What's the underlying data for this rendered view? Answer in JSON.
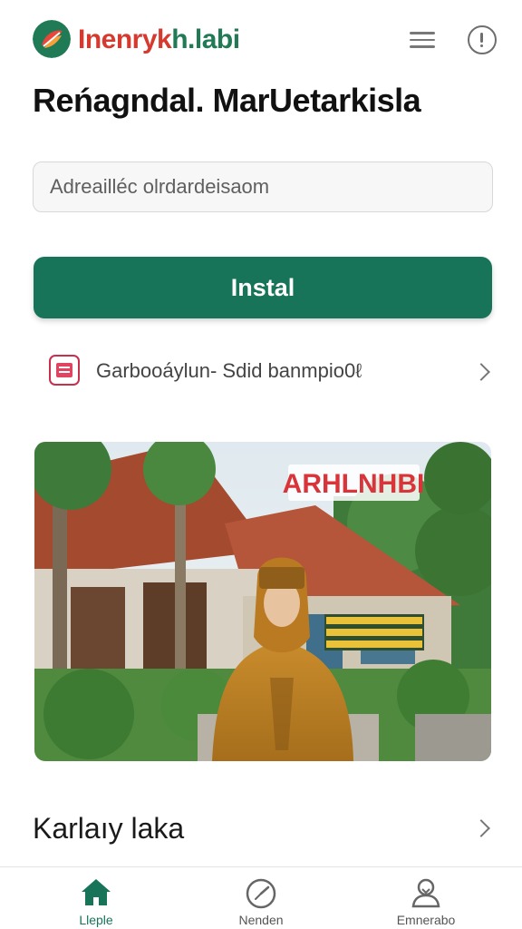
{
  "header": {
    "brand_part1": "Inenryk",
    "brand_part2": "h.labi",
    "icons": {
      "logo": "leaf-logo",
      "menu": "hamburger-icon",
      "info": "info-icon"
    }
  },
  "page": {
    "title": "Reńagndal. MarUetarkisla"
  },
  "search": {
    "placeholder": "Adreailléc olrdardeisaom"
  },
  "install_button": {
    "label": "Instal"
  },
  "promo": {
    "text": "Garbooáylun- Sdid banmpio0ℓ",
    "icon": "app-calendar-icon"
  },
  "hero": {
    "image": "woman in golden hijab before a traditional house",
    "sign_text": "ARHLNHBI"
  },
  "section": {
    "title": "Karlaıy laka"
  },
  "bottom_nav": [
    {
      "label": "Lleple",
      "icon": "home-icon",
      "active": true
    },
    {
      "label": "Nenden",
      "icon": "clock-icon",
      "active": false
    },
    {
      "label": "Emnerabo",
      "icon": "profile-icon",
      "active": false
    }
  ],
  "colors": {
    "primary": "#177459",
    "brand_red": "#d63a2e",
    "accent_pink": "#c7304d"
  }
}
